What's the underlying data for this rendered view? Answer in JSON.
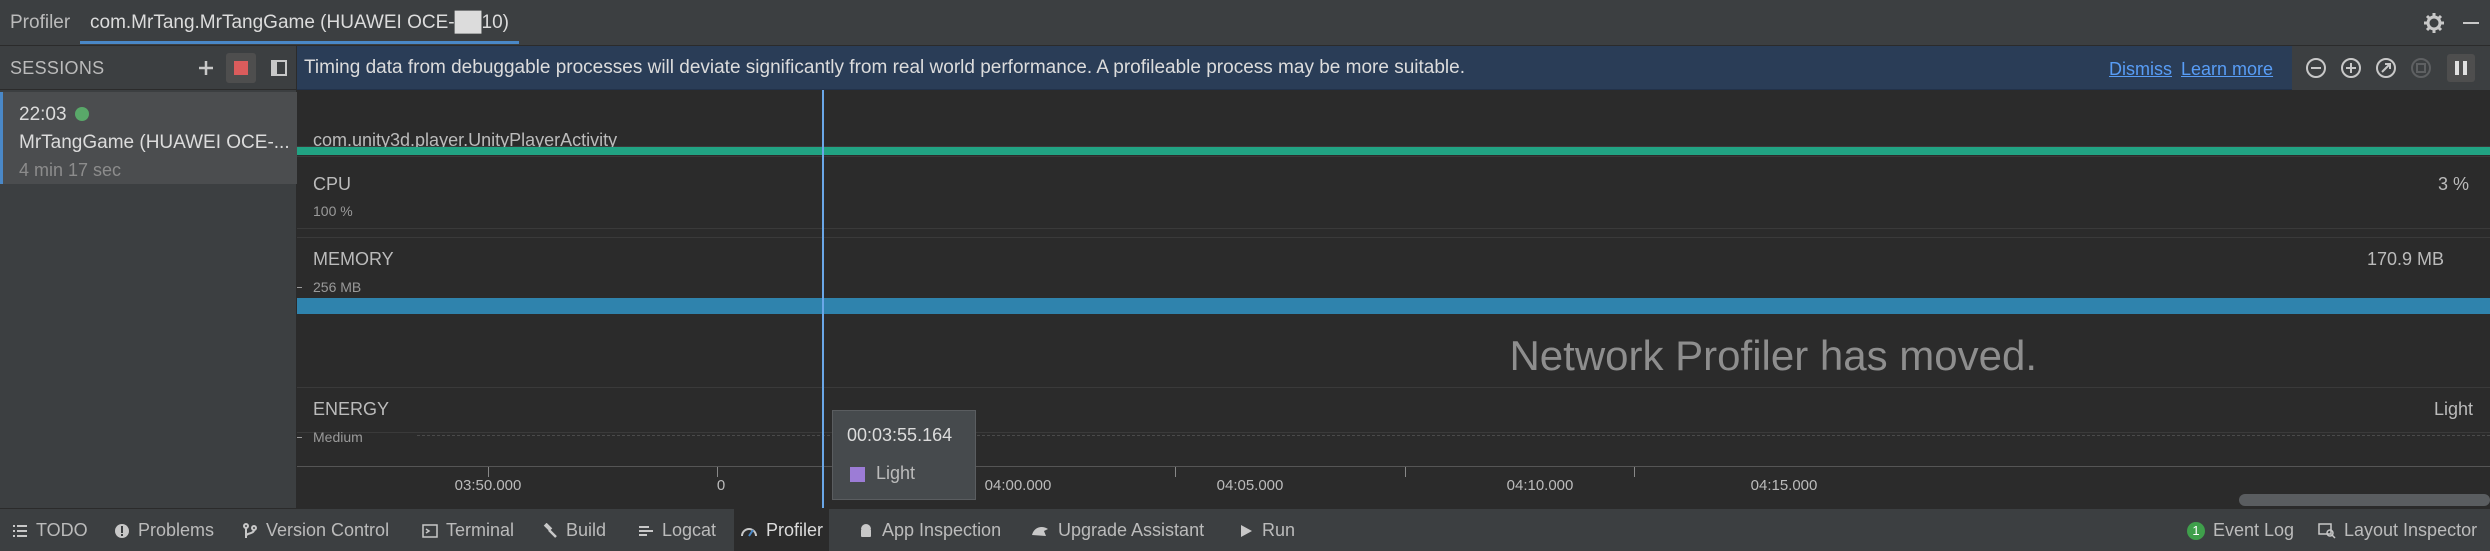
{
  "tabs": {
    "profiler": "Profiler",
    "session": "com.MrTang.MrTangGame (HUAWEI OCE-██10)"
  },
  "sessions": {
    "title": "SESSIONS",
    "item": {
      "time": "22:03",
      "name": "MrTangGame (HUAWEI OCE-...",
      "duration": "4 min 17 sec"
    }
  },
  "banner": {
    "message": "Timing data from debuggable processes will deviate significantly from real world performance. A profileable process may be more suitable.",
    "dismiss": "Dismiss",
    "learn_more": "Learn more"
  },
  "lanes": {
    "activity": "com.unity3d.player.UnityPlayerActivity",
    "cpu": {
      "label": "CPU",
      "scale": "100 %",
      "value": "3 %"
    },
    "memory": {
      "label": "MEMORY",
      "scale": "256 MB",
      "value": "170.9 MB"
    },
    "network_moved": "Network Profiler has moved.",
    "energy": {
      "label": "ENERGY",
      "scale": "Medium",
      "value": "Light"
    }
  },
  "axis": {
    "labels": [
      "03:50.000",
      "0",
      "04:00.000",
      "04:05.000",
      "04:10.000",
      "04:15.000"
    ]
  },
  "tooltip": {
    "time": "00:03:55.164",
    "level": "Light",
    "swatch_color": "#9c7cd6"
  },
  "toolwindows": {
    "todo": "TODO",
    "problems": "Problems",
    "version_control": "Version Control",
    "terminal": "Terminal",
    "build": "Build",
    "logcat": "Logcat",
    "profiler": "Profiler",
    "app_inspection": "App Inspection",
    "upgrade_assistant": "Upgrade Assistant",
    "run": "Run",
    "event_log": "Event Log",
    "event_log_count": "1",
    "layout_inspector": "Layout Inspector"
  },
  "colors": {
    "accent": "#4a88c7",
    "activity_bar": "#21a383",
    "memory_bar": "#2f83ad",
    "banner_bg": "#2a3d57",
    "link": "#589df6",
    "session_active_dot": "#59a869"
  }
}
